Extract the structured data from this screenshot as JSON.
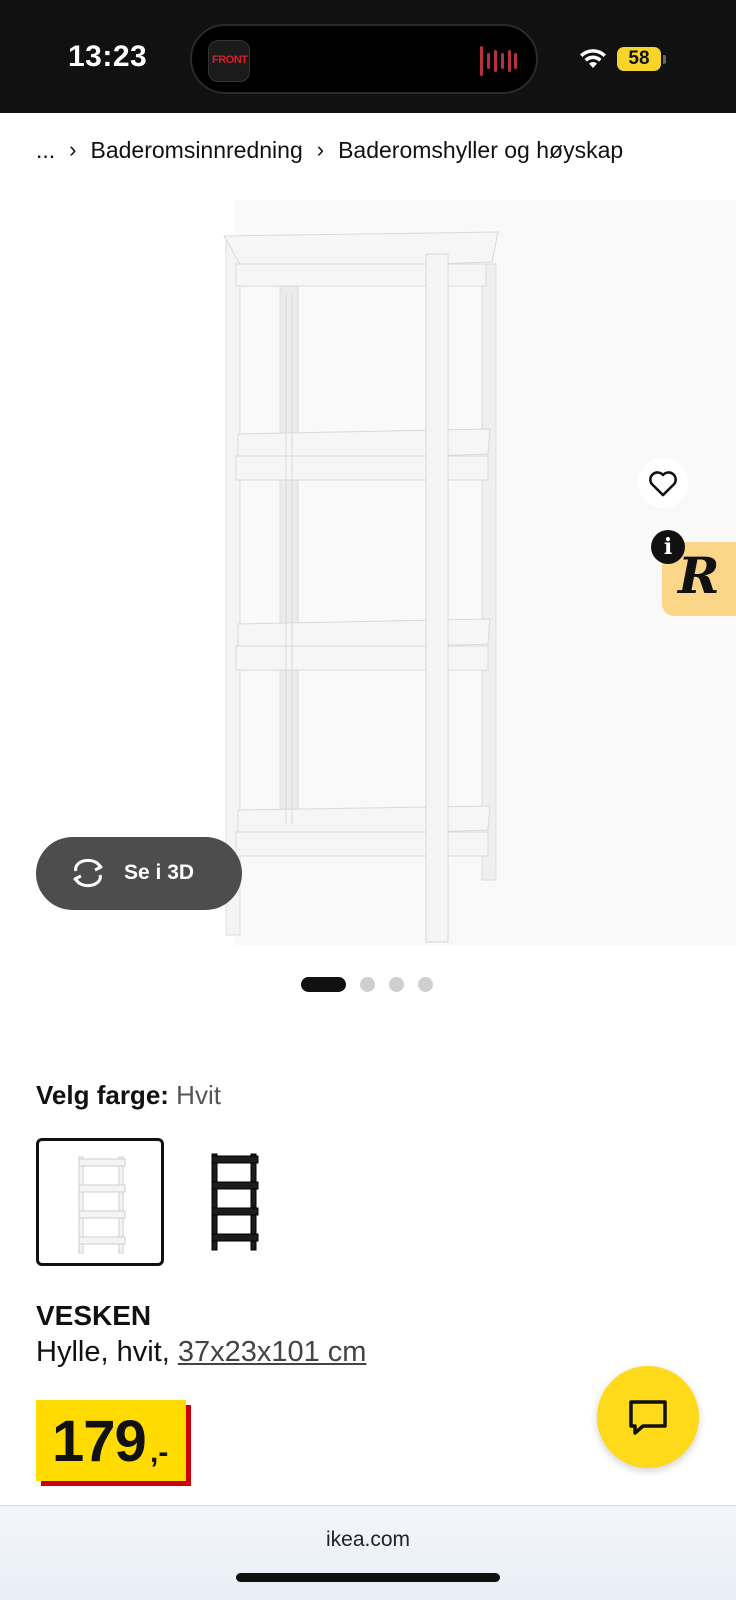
{
  "status_bar": {
    "time": "13:23",
    "island_app_label": "FRONT",
    "battery": "58"
  },
  "breadcrumb": {
    "ellipsis": "...",
    "separator": "›",
    "items": [
      "Baderomsinnredning",
      "Baderomshyller og høyskap"
    ]
  },
  "gallery": {
    "view_3d_label": "Se i 3D",
    "image_count": 4,
    "active_index": 0
  },
  "color_selector": {
    "label": "Velg farge:",
    "selected_value": "Hvit",
    "options": [
      "white",
      "black"
    ]
  },
  "product": {
    "name": "VESKEN",
    "description_prefix": "Hylle, hvit, ",
    "dimensions": "37x23x101 cm"
  },
  "price": {
    "integer": "179",
    "suffix": ",-",
    "colors": {
      "background": "#ffdb00",
      "shadow": "#cc0008"
    }
  },
  "browser": {
    "url": "ikea.com"
  },
  "icons": {
    "favorite": "heart-icon",
    "rotate": "rotate-3d-icon",
    "chat": "chat-bubble-icon",
    "wifi": "wifi-icon",
    "info": "info-icon"
  }
}
